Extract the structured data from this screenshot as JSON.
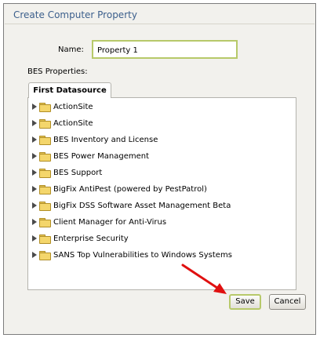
{
  "dialog": {
    "title": "Create Computer Property",
    "name_label": "Name:",
    "name_value": "Property 1",
    "properties_label": "BES Properties:",
    "tab_label": "First Datasource",
    "save_label": "Save",
    "cancel_label": "Cancel",
    "accent_color": "#3c5f8c",
    "focus_color": "#b7c96a",
    "annotation_color": "#e01010"
  },
  "tree": {
    "items": [
      {
        "label": "ActionSite",
        "icon": "folder-icon"
      },
      {
        "label": "ActionSite",
        "icon": "folder-icon"
      },
      {
        "label": "BES Inventory and License",
        "icon": "folder-icon"
      },
      {
        "label": "BES Power Management",
        "icon": "folder-icon"
      },
      {
        "label": "BES Support",
        "icon": "folder-icon"
      },
      {
        "label": "BigFix AntiPest (powered by PestPatrol)",
        "icon": "folder-icon"
      },
      {
        "label": "BigFix DSS Software Asset Management Beta",
        "icon": "folder-icon"
      },
      {
        "label": "Client Manager for Anti-Virus",
        "icon": "folder-icon"
      },
      {
        "label": "Enterprise Security",
        "icon": "folder-icon"
      },
      {
        "label": "SANS Top Vulnerabilities to Windows Systems",
        "icon": "folder-icon"
      }
    ]
  }
}
